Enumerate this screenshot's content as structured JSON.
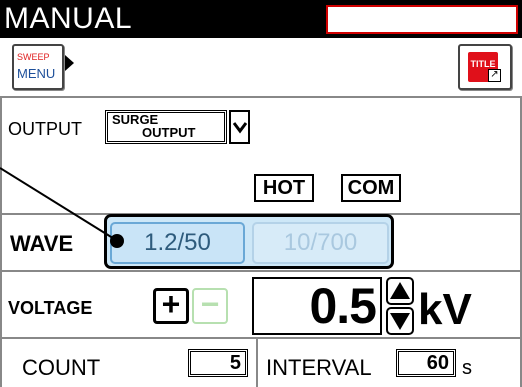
{
  "header": {
    "title": "MANUAL",
    "title_field_value": ""
  },
  "toolbar": {
    "sweep_menu": {
      "top_label": "SWEEP",
      "bottom_label": "MENU",
      "icon": "right-triangle-arrow"
    },
    "title_button": {
      "label": "TITLE",
      "icon": "external-arrow-icon"
    }
  },
  "output": {
    "label": "OUTPUT",
    "selected_line1": "SURGE",
    "selected_line2": "OUTPUT",
    "dropdown_icon": "chevron-down-icon"
  },
  "terminals": {
    "hot": "HOT",
    "com": "COM"
  },
  "wave": {
    "label": "WAVE",
    "options": [
      {
        "label": "1.2/50",
        "selected": true
      },
      {
        "label": "10/700",
        "selected": false
      }
    ]
  },
  "voltage": {
    "label": "VOLTAGE",
    "plus_label": "+",
    "minus_label": "−",
    "value": "0.5",
    "unit": "kV"
  },
  "count": {
    "label": "COUNT",
    "value": "5"
  },
  "interval": {
    "label": "INTERVAL",
    "value": "60",
    "unit": "s"
  },
  "colors": {
    "title_bar": "#000000",
    "title_field_border": "#d00000",
    "wave_highlight": "#cde7f7",
    "title_icon": "#e0101a",
    "minus_disabled": "#b7e0b0"
  }
}
